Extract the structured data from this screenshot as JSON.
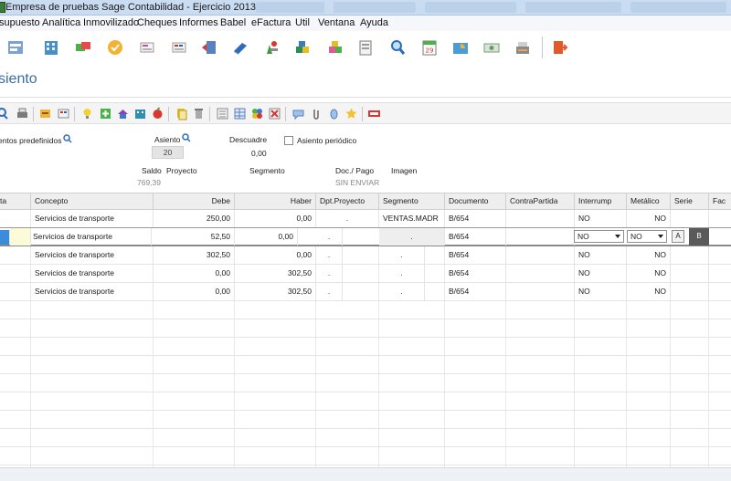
{
  "window": {
    "title": "Empresa de pruebas Sage Contabilidad - Ejercicio 2013"
  },
  "menu": [
    {
      "label": "supuesto"
    },
    {
      "label": "Analítica"
    },
    {
      "label": "Inmovilizado"
    },
    {
      "label": "Cheques"
    },
    {
      "label": "Informes"
    },
    {
      "label": "Babel"
    },
    {
      "label": "eFactura"
    },
    {
      "label": "Util"
    },
    {
      "label": "Ventana"
    },
    {
      "label": "Ayuda"
    }
  ],
  "main_toolbar": {
    "icons": [
      "sales-icon",
      "building-icon",
      "cards-icon",
      "check-icon",
      "invoice-icon",
      "invoice-alt-icon",
      "book-arrow-icon",
      "books-icon",
      "tools-icon",
      "cubes-icon",
      "cubes-alt-icon",
      "document-icon",
      "search-icon",
      "calendar-icon",
      "pie-chart-icon",
      "money-icon",
      "cashier-icon",
      "exit-icon"
    ],
    "calendar_day": "29"
  },
  "page": {
    "title": "siento"
  },
  "sub_toolbar": {
    "icons": [
      "search-icon",
      "print-icon",
      "notes-icon",
      "card-icon",
      "bulb-icon",
      "add-icon",
      "house-icon",
      "building-icon",
      "apple-icon",
      "copy-icon",
      "trash-icon",
      "list-icon",
      "table-icon",
      "cluster-icon",
      "delete-icon",
      "comment-icon",
      "attach-icon",
      "clip-icon",
      "star-icon",
      "flag-icon"
    ]
  },
  "form": {
    "predefined_label": "entos predefinidos",
    "asiento_label": "Asiento",
    "asiento_value": "20",
    "descuadre_label": "Descuadre",
    "descuadre_value": "0,00",
    "periodic_label": "Asiento periódico",
    "saldo_label": "Saldo",
    "saldo_value": "769,39",
    "proyecto_label": "Proyecto",
    "segmento_label": "Segmento",
    "doc_pago_label": "Doc./ Pago",
    "doc_pago_value": "SIN ENVIAR",
    "imagen_label": "Imagen"
  },
  "grid": {
    "columns": [
      {
        "label": "ta"
      },
      {
        "label": "Concepto"
      },
      {
        "label": "Debe"
      },
      {
        "label": "Haber"
      },
      {
        "label": "Dpt.Proyecto"
      },
      {
        "label": "Segmento"
      },
      {
        "label": "Documento"
      },
      {
        "label": "ContraPartida"
      },
      {
        "label": "Interrump"
      },
      {
        "label": "Metálico"
      },
      {
        "label": "Serie"
      },
      {
        "label": "Fac"
      }
    ],
    "rows": [
      {
        "concepto": "Servicios de transporte",
        "debe": "250,00",
        "haber": "0,00",
        "dpt": ".",
        "segmento": "VENTAS.MADR",
        "documento": "B/654",
        "contrapartida": "",
        "interrump": "NO",
        "metalico": "NO",
        "serie": ""
      },
      {
        "concepto": "Servicios de transporte",
        "debe": "52,50",
        "haber": "0,00",
        "dpt": ".",
        "segmento": ".",
        "documento": "B/654",
        "contrapartida": "",
        "interrump": "NO",
        "metalico": "NO",
        "serie_a": "A",
        "serie_b": "B"
      },
      {
        "concepto": "Servicios de transporte",
        "debe": "302,50",
        "haber": "0,00",
        "dpt": ".",
        "segmento": ".",
        "documento": "B/654",
        "contrapartida": "",
        "interrump": "NO",
        "metalico": "NO",
        "serie": ""
      },
      {
        "concepto": "Servicios de transporte",
        "debe": "0,00",
        "haber": "302,50",
        "dpt": ".",
        "segmento": ".",
        "documento": "B/654",
        "contrapartida": "",
        "interrump": "NO",
        "metalico": "NO",
        "serie": ""
      },
      {
        "concepto": "Servicios de transporte",
        "debe": "0,00",
        "haber": "302,50",
        "dpt": ".",
        "segmento": ".",
        "documento": "B/654",
        "contrapartida": "",
        "interrump": "NO",
        "metalico": "NO",
        "serie": ""
      }
    ]
  },
  "colors": {
    "title_blue": "#3a6ea5",
    "selection_blue": "#3c8cdc",
    "edit_yellow": "#fbfbd8"
  }
}
